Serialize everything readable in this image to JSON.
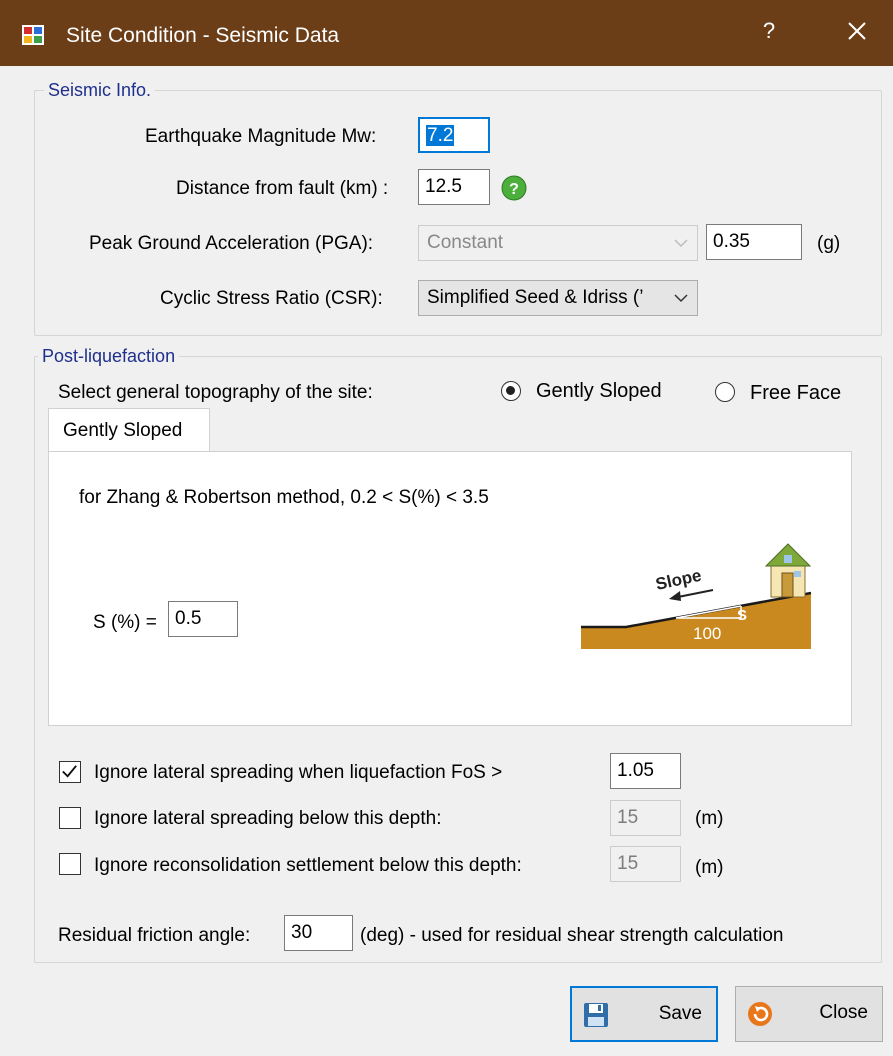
{
  "window": {
    "title": "Site Condition - Seismic Data",
    "help_label": "?"
  },
  "seismic": {
    "legend": "Seismic Info.",
    "magnitude_label": "Earthquake Magnitude Mw:",
    "magnitude_value": "7.2",
    "distance_label": "Distance from fault (km) :",
    "distance_value": "12.5",
    "pga_label": "Peak Ground Acceleration (PGA):",
    "pga_mode": "Constant",
    "pga_value": "0.35",
    "pga_unit": "(g)",
    "csr_label": "Cyclic Stress Ratio (CSR):",
    "csr_value": "Simplified Seed & Idriss (’"
  },
  "post": {
    "legend": "Post-liquefaction",
    "topo_label": "Select general topography of the site:",
    "radio_gently": "Gently Sloped",
    "radio_free": "Free Face",
    "selected_topography": "Gently Sloped",
    "tab_label": "Gently Sloped",
    "method_note": "for Zhang & Robertson method, 0.2 < S(%) < 3.5",
    "s_label": "S (%) =",
    "s_value": "0.5",
    "diagram": {
      "slope_text": "Slope",
      "s_text": "S",
      "run_text": "100"
    },
    "opt1_label": "Ignore lateral spreading when liquefaction FoS >",
    "opt1_checked": true,
    "opt1_value": "1.05",
    "opt2_label": "Ignore lateral spreading below this depth:",
    "opt2_checked": false,
    "opt2_value": "15",
    "opt2_unit": "(m)",
    "opt3_label": "Ignore reconsolidation settlement below this depth:",
    "opt3_checked": false,
    "opt3_value": "15",
    "opt3_unit": "(m)",
    "friction_label": "Residual friction angle:",
    "friction_value": "30",
    "friction_note": "(deg) - used for residual shear strength calculation"
  },
  "buttons": {
    "save": "Save",
    "close": "Close"
  },
  "colors": {
    "titlebar": "#6b3e18",
    "legend_text": "#1f2f8c",
    "ground": "#c9891f",
    "accent": "#0078d7",
    "help_icon": "#4caf3c",
    "close_icon": "#e8761a"
  },
  "icons": {
    "app": "app-icon",
    "help": "help-icon",
    "close": "close-icon",
    "save": "save-icon",
    "cancel": "cancel-icon"
  }
}
